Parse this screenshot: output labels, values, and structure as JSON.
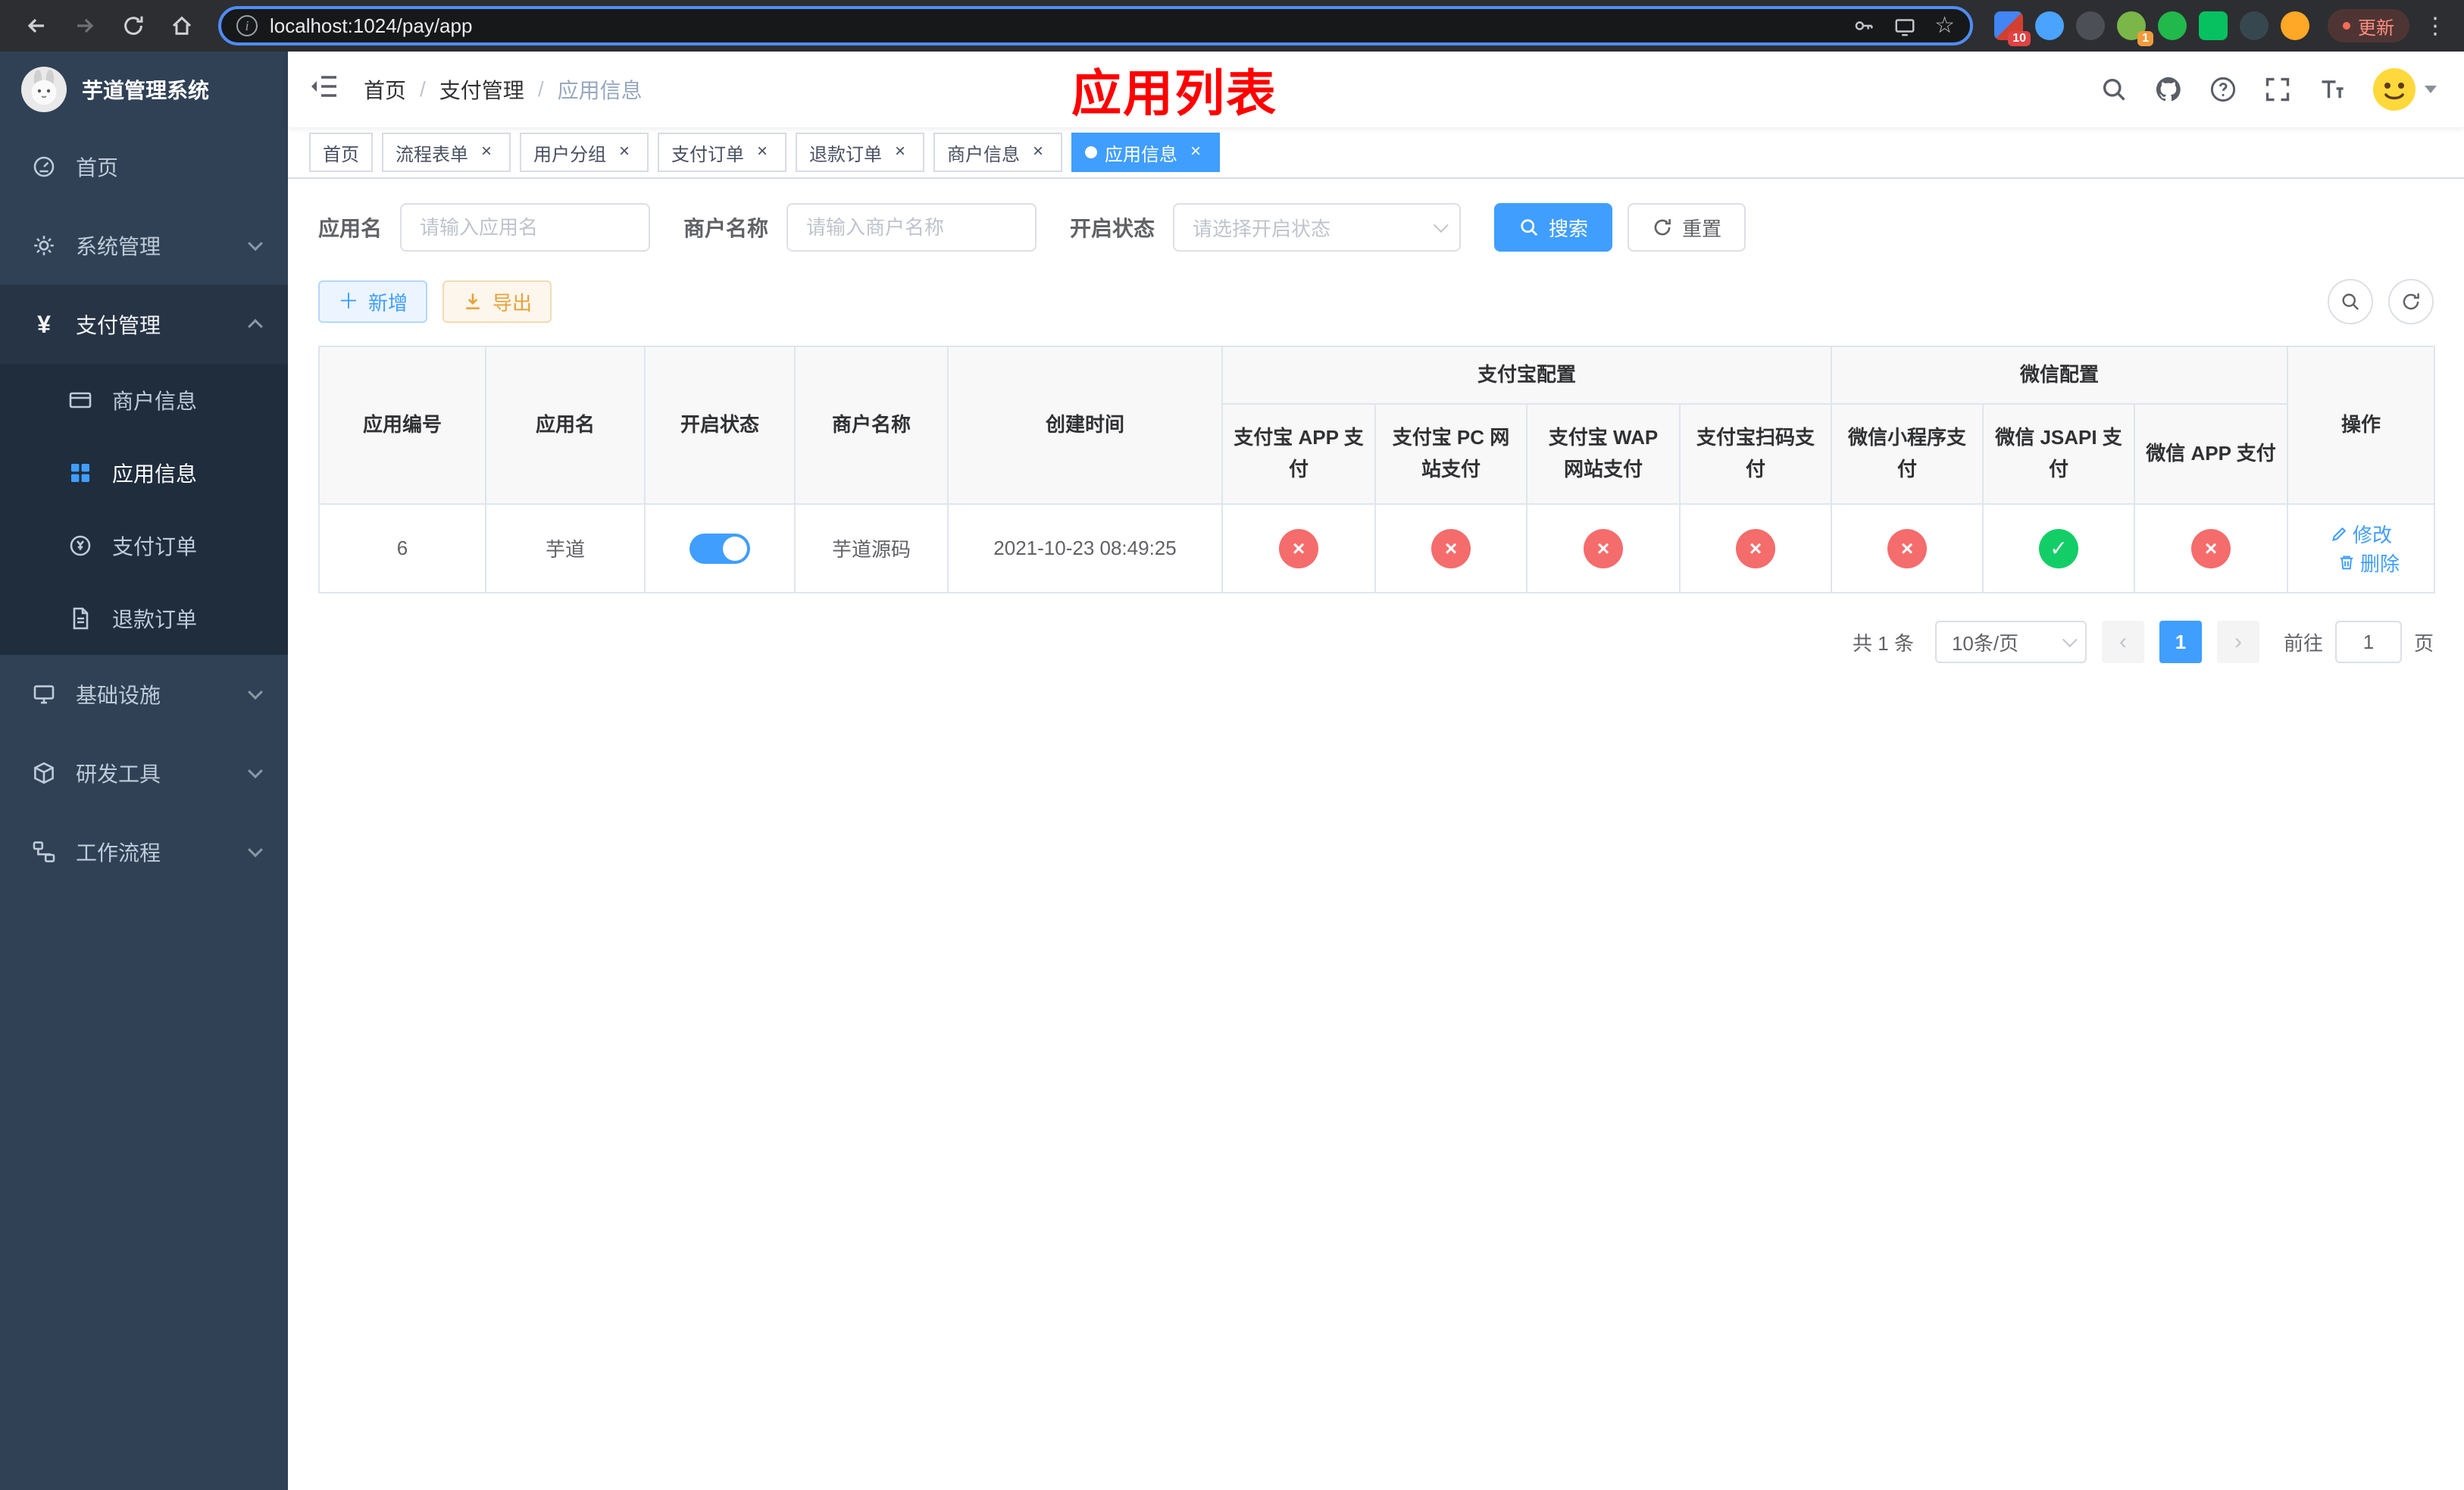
{
  "browser": {
    "url": "localhost:1024/pay/app",
    "update_button": "更新",
    "extension_badge_1": "10",
    "extension_badge_2": "1"
  },
  "sidebar": {
    "title": "芋道管理系统",
    "home": "首页",
    "system": "系统管理",
    "payment": "支付管理",
    "merchant_info": "商户信息",
    "app_info": "应用信息",
    "pay_order": "支付订单",
    "refund_order": "退款订单",
    "infrastructure": "基础设施",
    "dev_tools": "研发工具",
    "workflow": "工作流程"
  },
  "header": {
    "breadcrumb": [
      "首页",
      "支付管理",
      "应用信息"
    ],
    "title": "应用列表"
  },
  "tabs": [
    {
      "label": "首页",
      "closable": false,
      "active": false
    },
    {
      "label": "流程表单",
      "closable": true,
      "active": false
    },
    {
      "label": "用户分组",
      "closable": true,
      "active": false
    },
    {
      "label": "支付订单",
      "closable": true,
      "active": false
    },
    {
      "label": "退款订单",
      "closable": true,
      "active": false
    },
    {
      "label": "商户信息",
      "closable": true,
      "active": false
    },
    {
      "label": "应用信息",
      "closable": true,
      "active": true
    }
  ],
  "filters": {
    "app_name_label": "应用名",
    "app_name_placeholder": "请输入应用名",
    "merchant_label": "商户名称",
    "merchant_placeholder": "请输入商户名称",
    "status_label": "开启状态",
    "status_placeholder": "请选择开启状态",
    "search_button": "搜索",
    "reset_button": "重置"
  },
  "toolbar": {
    "add_button": "新增",
    "export_button": "导出"
  },
  "table": {
    "group_alipay": "支付宝配置",
    "group_wechat": "微信配置",
    "col_id": "应用编号",
    "col_name": "应用名",
    "col_status": "开启状态",
    "col_merchant": "商户名称",
    "col_created": "创建时间",
    "col_alipay_app": "支付宝 APP 支付",
    "col_alipay_pc": "支付宝 PC 网站支付",
    "col_alipay_wap": "支付宝 WAP 网站支付",
    "col_alipay_qr": "支付宝扫码支付",
    "col_wx_lite": "微信小程序支付",
    "col_wx_jsapi": "微信 JSAPI 支付",
    "col_wx_app": "微信 APP 支付",
    "col_actions": "操作",
    "rows": [
      {
        "id": "6",
        "name": "芋道",
        "enabled": true,
        "merchant": "芋道源码",
        "created": "2021-10-23 08:49:25",
        "alipay_app": false,
        "alipay_pc": false,
        "alipay_wap": false,
        "alipay_qr": false,
        "wx_lite": false,
        "wx_jsapi": true,
        "wx_app": false,
        "edit_label": "修改",
        "delete_label": "删除"
      }
    ]
  },
  "pagination": {
    "total_label": "共 1 条",
    "page_size_label": "10条/页",
    "current_page": "1",
    "goto_label": "前往",
    "goto_value": "1",
    "goto_unit": "页"
  },
  "colors": {
    "primary": "#409EFF",
    "danger": "#F56C6C",
    "success": "#13CE66",
    "page_title_red": "#FF0000",
    "sidebar_bg": "#304156",
    "submenu_bg": "#1F2D3D"
  }
}
